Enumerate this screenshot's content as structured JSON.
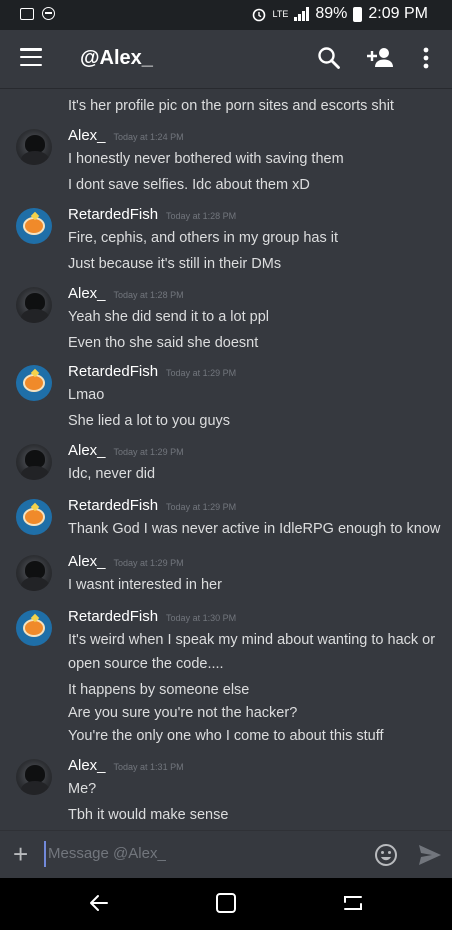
{
  "status_bar": {
    "network": "LTE",
    "battery": "89%",
    "time": "2:09 PM"
  },
  "header": {
    "title": "@Alex_",
    "icons": [
      "menu-icon",
      "search-icon",
      "add-friend-icon",
      "more-icon"
    ]
  },
  "messages": {
    "partial_line": "It's her profile pic on the porn sites and escorts shit",
    "groups": [
      {
        "author": "Alex_",
        "time": "Today at 1:24 PM",
        "lines": [
          "I honestly never bothered with saving them",
          "I dont save selfies. Idc about them xD"
        ]
      },
      {
        "author": "RetardedFish",
        "time": "Today at 1:28 PM",
        "lines": [
          "Fire, cephis, and others in my group has it",
          "Just because it's still in their DMs"
        ]
      },
      {
        "author": "Alex_",
        "time": "Today at 1:28 PM",
        "lines": [
          "Yeah she did send it  to a lot ppl",
          "Even tho she said she doesnt"
        ]
      },
      {
        "author": "RetardedFish",
        "time": "Today at 1:29 PM",
        "lines": [
          "Lmao",
          "She lied a lot to you guys"
        ]
      },
      {
        "author": "Alex_",
        "time": "Today at 1:29 PM",
        "lines": [
          "Idc, never did"
        ]
      },
      {
        "author": "RetardedFish",
        "time": "Today at 1:29 PM",
        "lines": [
          "Thank God I was never active in IdleRPG enough to know"
        ]
      },
      {
        "author": "Alex_",
        "time": "Today at 1:29 PM",
        "lines": [
          "I wasnt interested in her"
        ]
      },
      {
        "author": "RetardedFish",
        "time": "Today at 1:30 PM",
        "lines": [
          "It's weird when I speak my mind about wanting to hack or",
          "open source the code....",
          "It happens by someone else",
          "Are you sure you're not the hacker?",
          "You're the only one who I come to about this stuff"
        ]
      },
      {
        "author": "Alex_",
        "time": "Today at 1:31 PM",
        "lines": [
          "Me?",
          "Tbh it would make sense"
        ]
      }
    ]
  },
  "composer": {
    "placeholder": "Message @Alex_"
  },
  "colors": {
    "background": "#36393f",
    "status_bar": "#1e2124",
    "accent": "#7289da"
  }
}
